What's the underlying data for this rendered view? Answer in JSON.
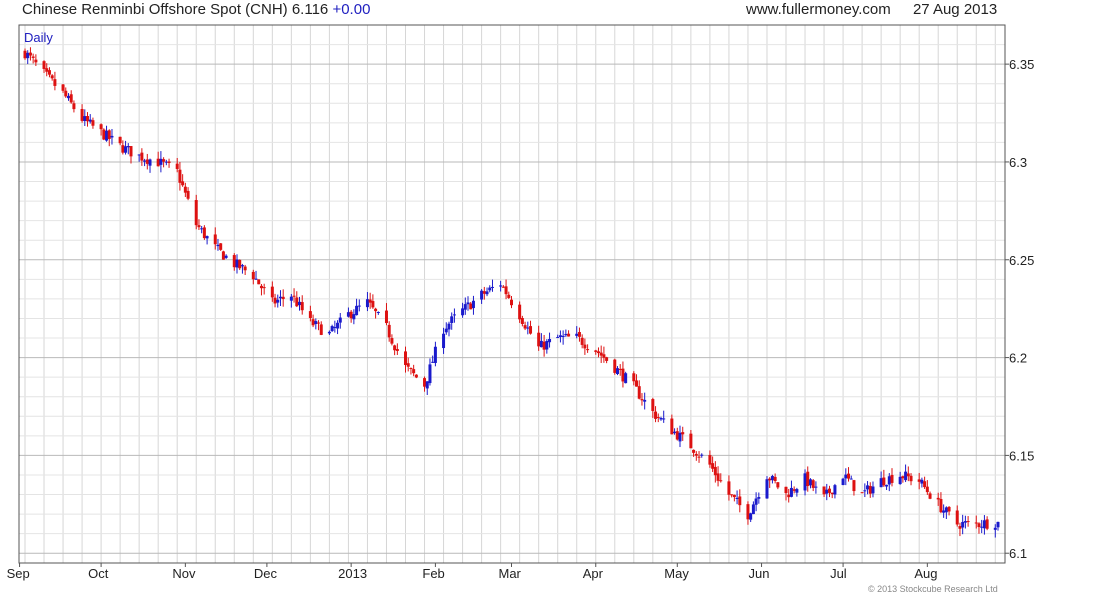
{
  "header": {
    "title": "Chinese Renminbi Offshore Spot (CNH)",
    "last": "6.116",
    "change": "+0.00",
    "source": "www.fullermoney.com",
    "date": "27 Aug 2013"
  },
  "footer": {
    "copyright": "© 2013 Stockcube Research Ltd"
  },
  "colors": {
    "up": "#1a1acc",
    "down": "#dd1111",
    "grid": "#d6d6d6",
    "frame": "#555555"
  },
  "chart_data": {
    "type": "candlestick",
    "frequency_label": "Daily",
    "ylim": [
      6.095,
      6.37
    ],
    "y_ticks": [
      "6.1",
      "6.15",
      "6.2",
      "6.25",
      "6.3",
      "6.35"
    ],
    "x_tick_labels": [
      "Sep",
      "Oct",
      "Nov",
      "Dec",
      "2013",
      "Feb",
      "Mar",
      "Apr",
      "May",
      "Jun",
      "Jul",
      "Aug"
    ],
    "x_start": "2012-09-03",
    "x_end": "2013-08-27",
    "x_tick_dates": [
      "2012-09-01",
      "2012-10-01",
      "2012-11-01",
      "2012-12-01",
      "2013-01-01",
      "2013-02-01",
      "2013-03-01",
      "2013-04-01",
      "2013-05-01",
      "2013-06-01",
      "2013-07-01",
      "2013-08-01"
    ],
    "close_path": [
      [
        "2012-09-03",
        6.356
      ],
      [
        "2012-09-10",
        6.345
      ],
      [
        "2012-09-17",
        6.335
      ],
      [
        "2012-09-24",
        6.322
      ],
      [
        "2012-10-01",
        6.315
      ],
      [
        "2012-10-08",
        6.308
      ],
      [
        "2012-10-15",
        6.303
      ],
      [
        "2012-10-22",
        6.3
      ],
      [
        "2012-10-29",
        6.295
      ],
      [
        "2012-11-05",
        6.268
      ],
      [
        "2012-11-12",
        6.256
      ],
      [
        "2012-11-19",
        6.248
      ],
      [
        "2012-11-26",
        6.242
      ],
      [
        "2012-12-03",
        6.228
      ],
      [
        "2012-12-10",
        6.232
      ],
      [
        "2012-12-17",
        6.218
      ],
      [
        "2012-12-24",
        6.212
      ],
      [
        "2012-12-31",
        6.222
      ],
      [
        "2013-01-07",
        6.228
      ],
      [
        "2013-01-14",
        6.215
      ],
      [
        "2013-01-21",
        6.195
      ],
      [
        "2013-01-28",
        6.186
      ],
      [
        "2013-02-04",
        6.215
      ],
      [
        "2013-02-11",
        6.224
      ],
      [
        "2013-02-18",
        6.232
      ],
      [
        "2013-02-25",
        6.238
      ],
      [
        "2013-03-04",
        6.222
      ],
      [
        "2013-03-11",
        6.205
      ],
      [
        "2013-03-18",
        6.21
      ],
      [
        "2013-03-25",
        6.21
      ],
      [
        "2013-04-01",
        6.204
      ],
      [
        "2013-04-08",
        6.195
      ],
      [
        "2013-04-15",
        6.185
      ],
      [
        "2013-04-22",
        6.172
      ],
      [
        "2013-04-29",
        6.163
      ],
      [
        "2013-05-06",
        6.155
      ],
      [
        "2013-05-13",
        6.145
      ],
      [
        "2013-05-20",
        6.13
      ],
      [
        "2013-05-27",
        6.12
      ],
      [
        "2013-06-03",
        6.14
      ],
      [
        "2013-06-10",
        6.13
      ],
      [
        "2013-06-17",
        6.138
      ],
      [
        "2013-06-24",
        6.128
      ],
      [
        "2013-07-01",
        6.14
      ],
      [
        "2013-07-08",
        6.13
      ],
      [
        "2013-07-15",
        6.137
      ],
      [
        "2013-07-22",
        6.14
      ],
      [
        "2013-07-29",
        6.137
      ],
      [
        "2013-08-05",
        6.125
      ],
      [
        "2013-08-12",
        6.115
      ],
      [
        "2013-08-19",
        6.115
      ],
      [
        "2013-08-27",
        6.116
      ]
    ],
    "last_close": 6.116
  }
}
